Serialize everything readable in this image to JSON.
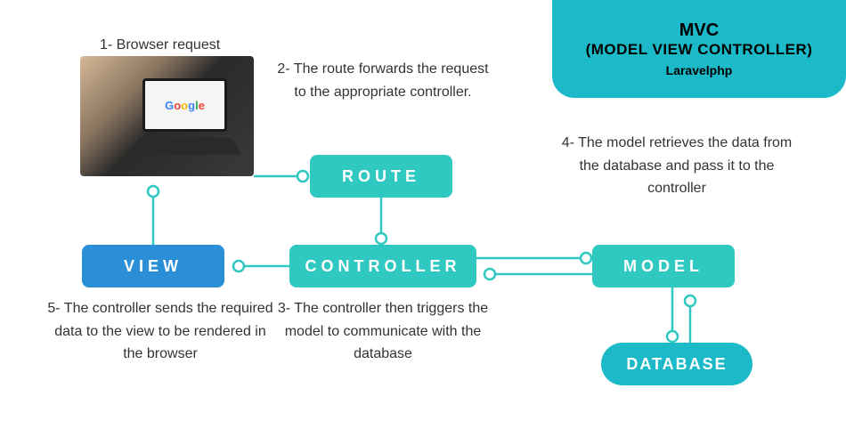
{
  "header": {
    "title": "MVC",
    "subtitle": "MODEL VIEW CONTROLLER",
    "tag": "Laravelphp"
  },
  "steps": {
    "s1": "1- Browser request",
    "s2": "2- The route forwards the request to the appropriate controller.",
    "s3": "3- The controller then triggers the model to communicate with the database",
    "s4": "4- The model retrieves the data from the database and pass it to the controller",
    "s5": "5- The controller sends the required data to the view to be rendered in the browser"
  },
  "nodes": {
    "route": "ROUTE",
    "controller": "CONTROLLER",
    "view": "VIEW",
    "model": "MODEL",
    "database": "DATABASE"
  },
  "photo": {
    "logo": "Google"
  }
}
